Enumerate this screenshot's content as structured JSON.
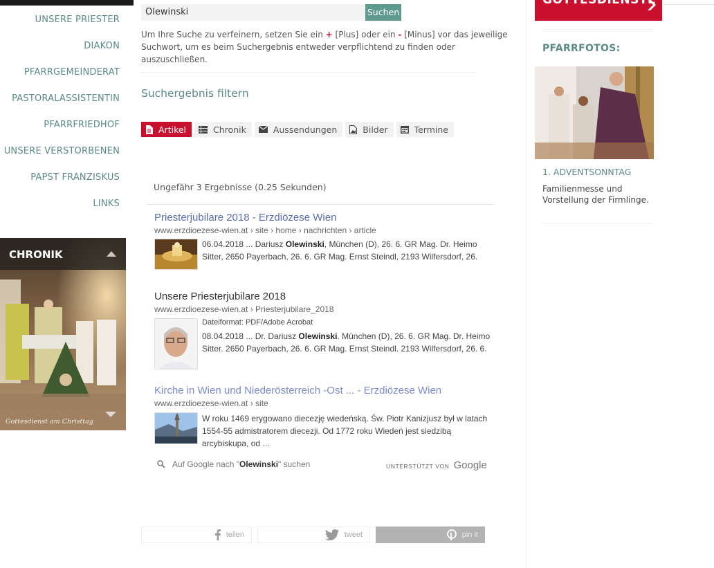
{
  "nav": {
    "items": [
      "UNSERE PRIESTER",
      "DIAKON",
      "PFARRGEMEINDERAT",
      "PASTORALASSISTENTIN",
      "PFARRFRIEDHOF",
      "UNSERE VERSTORBENEN",
      "PAPST FRANZISKUS",
      "LINKS"
    ]
  },
  "chronik": {
    "title": "CHRONIK",
    "caption": "Gottesdienst am Christtag"
  },
  "search": {
    "value": "Olewinski",
    "button_label": "Suchen",
    "hint_a": "Um Ihre Suche zu verfeinern, setzen Sie ein ",
    "hint_plus": "+",
    "hint_b": " [Plus] oder ein ",
    "hint_minus": "-",
    "hint_c": " [Minus] vor das jeweilige Suchwort, um es beim Suchergebnis entweder verpflichtend zu finden oder auszuschließen."
  },
  "filter": {
    "title": "Suchergebnis filtern",
    "tabs": [
      {
        "label": "Artikel",
        "icon": "document-icon"
      },
      {
        "label": "Chronik",
        "icon": "list-icon"
      },
      {
        "label": "Aussendungen",
        "icon": "envelope-icon"
      },
      {
        "label": "Bilder",
        "icon": "image-file-icon"
      },
      {
        "label": "Termine",
        "icon": "calendar-icon"
      }
    ]
  },
  "results": {
    "count_text": "Ungefähr 3 Ergebnisse (0.25 Sekunden)",
    "items": [
      {
        "title": "Priesterjubilare 2018 - Erzdiözese Wien",
        "url": "www.erzdioezese-wien.at › site › home › nachrichten › article",
        "meta": "",
        "snippet_a": "06.04.2018 ... Dariusz ",
        "snippet_bold": "Olewinski",
        "snippet_b": ", München (D), 26. 6. GR Mag. Dr. Heimo Sitter, 2650 Payerbach, 26. 6. GR Mag. Ernst Steindl, 2193 Wilfersdorf, 26."
      },
      {
        "title": "Unsere Priesterjubilare 2018",
        "url": "www.erzdioezese-wien.at › Priesterjubilare_2018",
        "meta": "Dateiformat: PDF/Adobe Acrobat",
        "snippet_a": "08.04.2018 ... Dr. Dariusz ",
        "snippet_bold": "Olewinski",
        "snippet_b": ". München (D), 26. 6. GR Mag. Dr. Heimo Sitter. 2650 Payerbach, 26. 6. GR Mag. Ernst Steindl. 2193 Wilfersdorf, 26. 6."
      },
      {
        "title": "Kirche in Wien und Niederösterreich -Ost ... - Erzdiözese Wien",
        "url": "www.erzdioezese-wien.at › site",
        "meta": "",
        "snippet_a": "W roku 1469 erygowano diecezję wiedeńską. Św. Piotr Kanizjusz był w latach 1554-55 admistratorem diecezji. Od 1772 roku Wiedeń jest siedzibą arcybiskupa, od ...",
        "snippet_bold": "",
        "snippet_b": ""
      }
    ],
    "google_a": "Auf Google nach \"",
    "google_term": "Olewinski",
    "google_b": "\" suchen",
    "powered_label": "UNTERSTÜTZT VON",
    "powered_brand": "Google"
  },
  "share": {
    "facebook": "teilen",
    "twitter": "tweet",
    "pinterest": "pin it"
  },
  "sidebar": {
    "gottesdienste_label": "GOTTESDIENSTE",
    "pfarrfotos_title": "PFARRFOTOS:",
    "photo_title": "1. ADVENTSONNTAG",
    "photo_desc": "Familienmesse und Vorstellung der Firmlinge."
  },
  "colors": {
    "accent_red": "#c8102e",
    "teal": "#5d8a86",
    "search_button": "#5e9b8e",
    "link_blue": "#5a6fb2"
  }
}
